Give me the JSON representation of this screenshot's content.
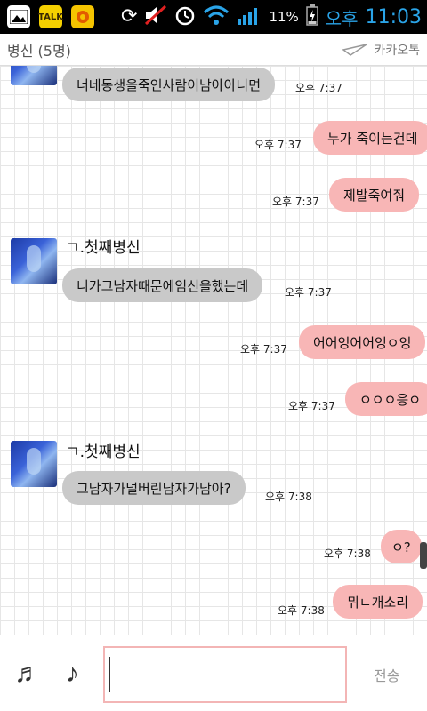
{
  "status_bar": {
    "left_icons": [
      "gallery-icon",
      "kakaotalk-icon",
      "notification-icon"
    ],
    "kakaotalk_badge": "TALK",
    "battery_pct": "11%",
    "ampm": "오후",
    "time": "11:03"
  },
  "header": {
    "title": "병신 (5명)",
    "brand": "카카오톡"
  },
  "messages": [
    {
      "side": "left",
      "text": "너네동생을죽인사람이남아아니면",
      "time": "오후 7:37"
    },
    {
      "side": "right",
      "text": "누가 죽이는건데",
      "time": "오후 7:37"
    },
    {
      "side": "right",
      "text": "제발죽여줘",
      "time": "오후 7:37"
    },
    {
      "side": "left",
      "sender": "ㄱ.첫째병신",
      "text": "니가그남자때문에임신을했는데",
      "time": "오후 7:37"
    },
    {
      "side": "right",
      "text": "어어엉어어엉ㅇ엉",
      "time": "오후 7:37"
    },
    {
      "side": "right",
      "text": "ㅇㅇㅇ응ㅇ",
      "time": "오후 7:37"
    },
    {
      "side": "left",
      "sender": "ㄱ.첫째병신",
      "text": "그남자가널버린남자가남아?",
      "time": "오후 7:38"
    },
    {
      "side": "right",
      "text": "ㅇ?",
      "time": "오후 7:38"
    },
    {
      "side": "right",
      "text": "뮈ㄴ개소리",
      "time": "오후 7:38"
    }
  ],
  "input_bar": {
    "send_label": "전송"
  }
}
